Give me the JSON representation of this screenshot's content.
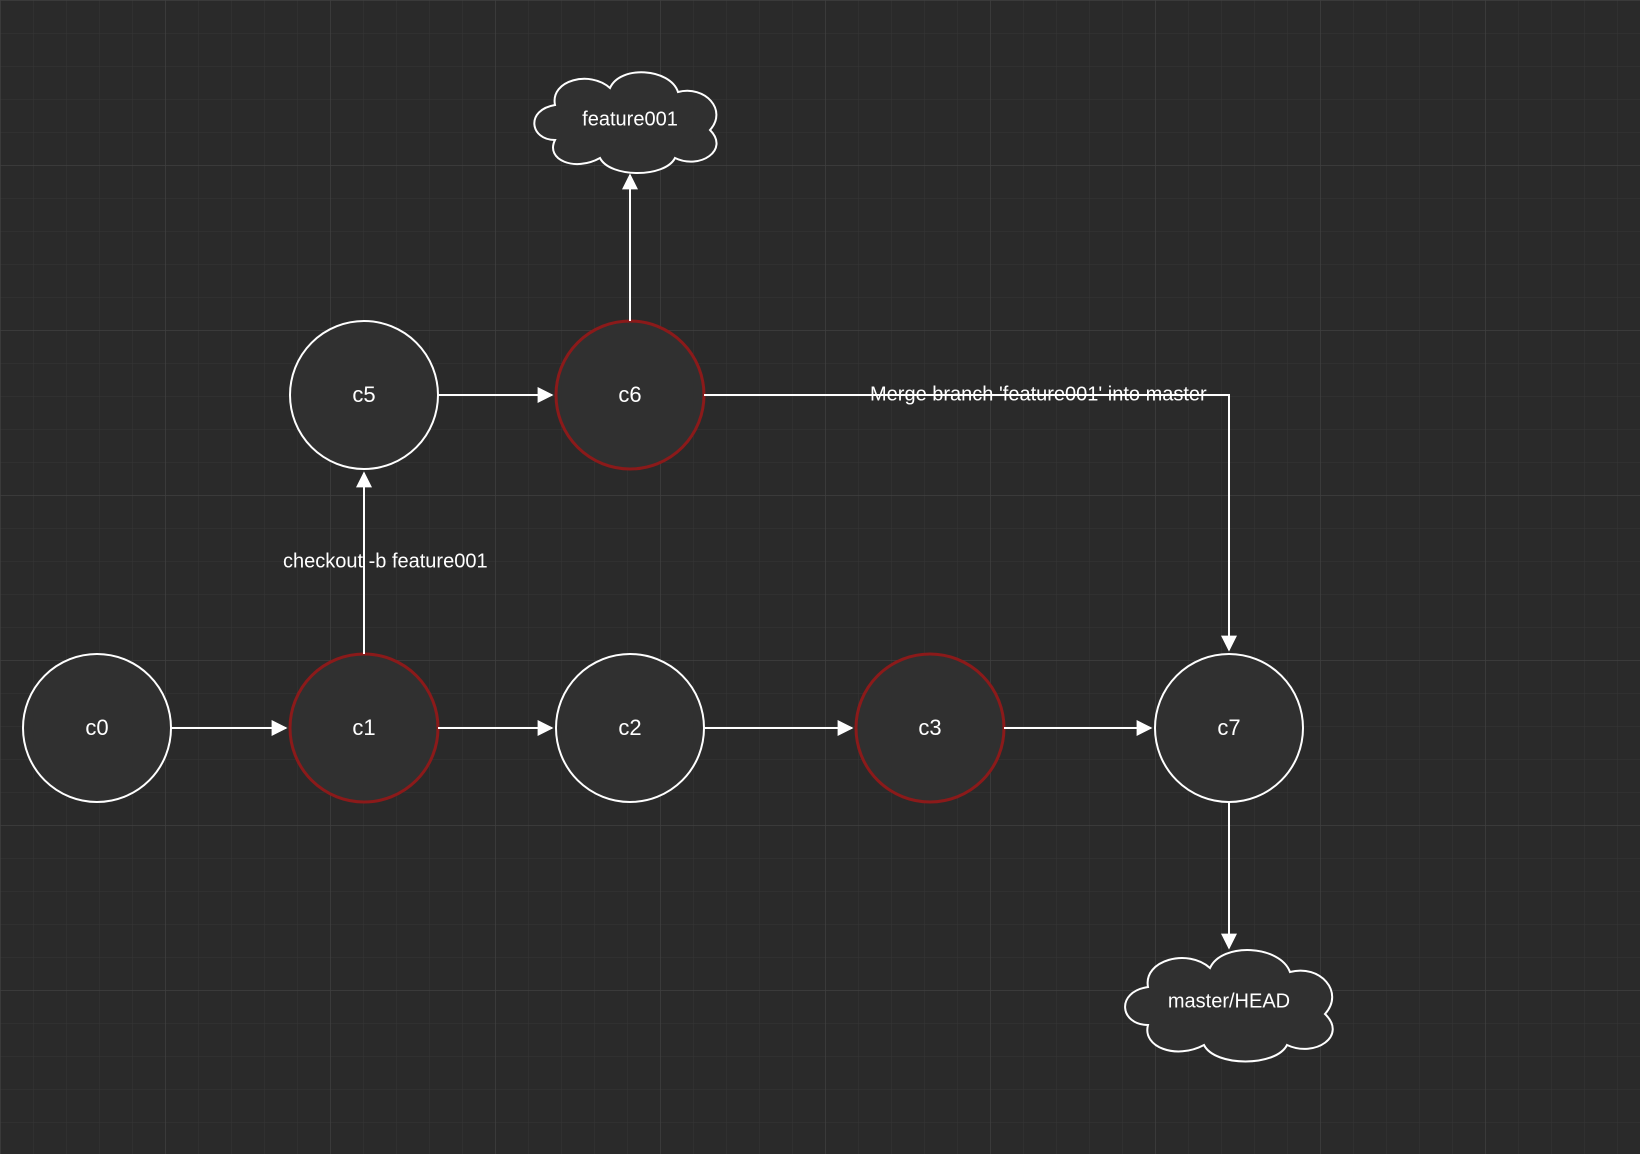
{
  "colors": {
    "bg": "#2a2a2a",
    "gridMinor": "#363636",
    "gridMajor": "#404040",
    "nodeFill": "#303030",
    "stroke": "#ffffff",
    "highlight": "#8b1a1a",
    "text": "#ffffff"
  },
  "nodes": {
    "c0": {
      "label": "c0"
    },
    "c1": {
      "label": "c1"
    },
    "c2": {
      "label": "c2"
    },
    "c3": {
      "label": "c3"
    },
    "c5": {
      "label": "c5"
    },
    "c6": {
      "label": "c6"
    },
    "c7": {
      "label": "c7"
    }
  },
  "clouds": {
    "feature": {
      "label": "feature001"
    },
    "master": {
      "label": "master/HEAD"
    }
  },
  "edgeLabels": {
    "checkout": "checkout -b feature001",
    "merge": "Merge branch 'feature001' into master"
  }
}
